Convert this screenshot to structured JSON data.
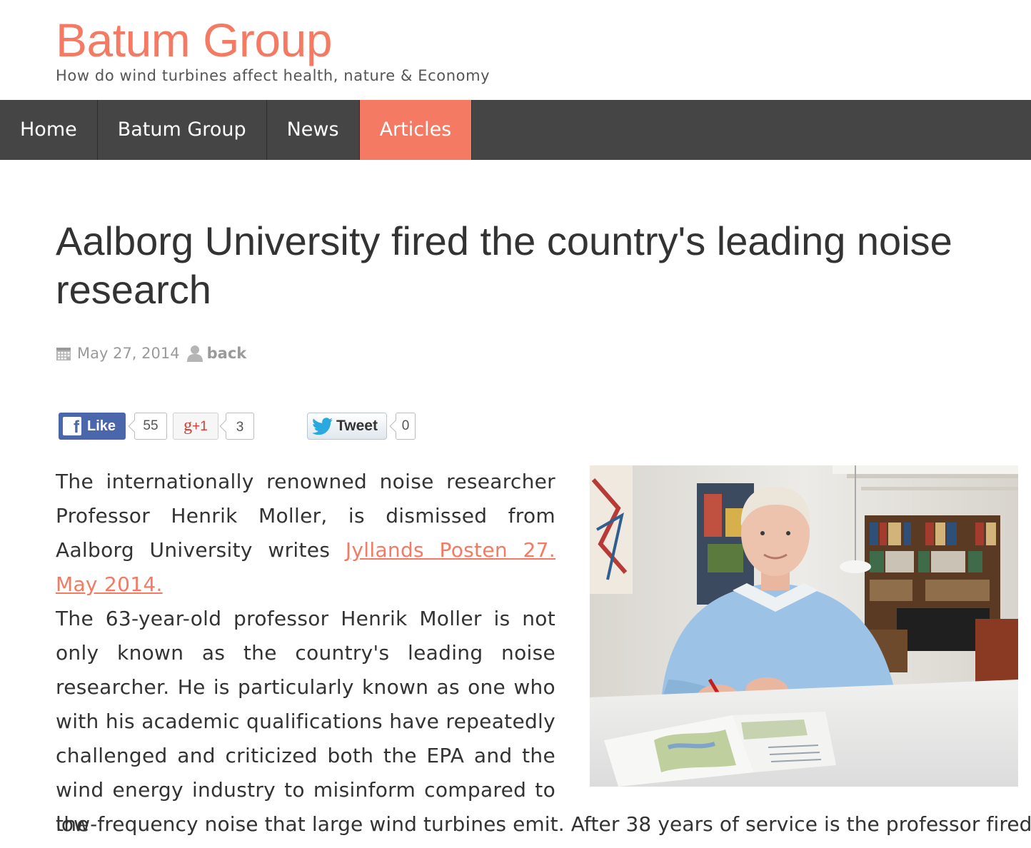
{
  "site": {
    "title": "Batum Group",
    "tagline": "How do wind turbines affect health, nature & Economy"
  },
  "nav": {
    "items": [
      {
        "label": "Home",
        "active": false
      },
      {
        "label": "Batum Group",
        "active": false
      },
      {
        "label": "News",
        "active": false
      },
      {
        "label": "Articles",
        "active": true
      }
    ]
  },
  "post": {
    "title": "Aalborg University fired the country's leading noise research",
    "date": "May 27, 2014",
    "author": "back"
  },
  "share": {
    "facebook_label": "Like",
    "facebook_count": "55",
    "gplus_label": "+1",
    "gplus_count": "3",
    "twitter_label": "Tweet",
    "twitter_count": "0"
  },
  "article": {
    "p1_text": "The internationally renowned noise researcher Professor Henrik Moller, is dismissed from Aalborg University writes ",
    "p1_link": "Jyllands Posten 27. May 2014.",
    "p2_text": "The 63-year-old professor Henrik Moller is not only known as the country's leading noise researcher. He is particularly known as one who with his academic qualifications have repeatedly challenged and criticized both the EPA and the wind energy industry to misinform compared to the",
    "p2_continued": "low-frequency noise that large wind turbines emit. After 38 years of service is the professor fired"
  },
  "colors": {
    "accent": "#f47a63",
    "nav_bg": "#454545",
    "text": "#333333",
    "meta": "#9a9a9a",
    "facebook": "#4967aa"
  },
  "icons": [
    "calendar-icon",
    "user-icon",
    "facebook-icon",
    "google-plus-icon",
    "twitter-bird-icon"
  ]
}
